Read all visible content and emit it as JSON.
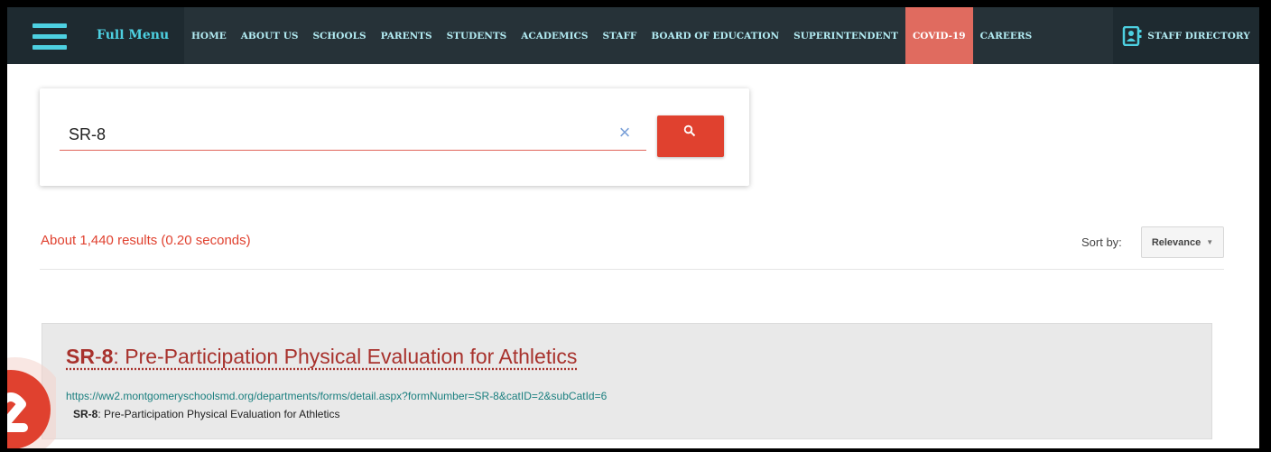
{
  "nav": {
    "menu_label": "Full Menu",
    "links": [
      "HOME",
      "ABOUT US",
      "SCHOOLS",
      "PARENTS",
      "STUDENTS",
      "ACADEMICS",
      "STAFF",
      "BOARD OF EDUCATION",
      "SUPERINTENDENT",
      "COVID-19",
      "CAREERS"
    ],
    "staff_directory": "STAFF DIRECTORY",
    "colors": {
      "bar": "#263238",
      "accent": "#4dd0e1",
      "covid": "#e06b5f"
    }
  },
  "search": {
    "value": "SR-8",
    "clear_icon": "×",
    "button_icon": "search-icon",
    "button_color": "#e0412f"
  },
  "results": {
    "summary": "About 1,440 results (0.20 seconds)",
    "sort_label": "Sort by:",
    "sort_value": "Relevance"
  },
  "result_item": {
    "title_highlight_1": "SR",
    "title_sep": "-",
    "title_highlight_2": "8",
    "title_rest": ": Pre-Participation Physical Evaluation for Athletics",
    "url": "https://ww2.montgomeryschoolsmd.org/departments/forms/detail.aspx?formNumber=SR-8&catID=2&subCatId=6",
    "snippet_highlight": "SR-8",
    "snippet_rest": ": Pre-Participation Physical Evaluation for Athletics"
  }
}
